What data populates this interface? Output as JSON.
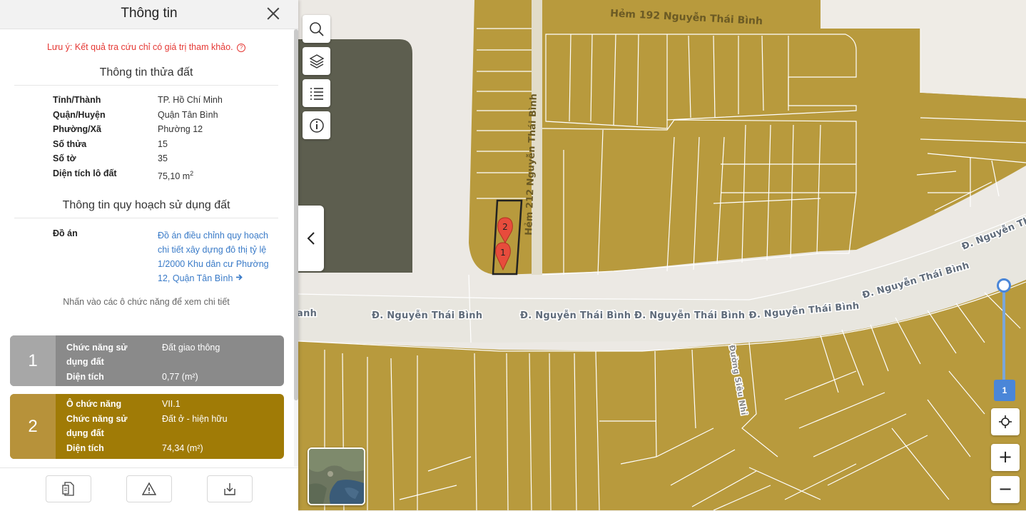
{
  "panel": {
    "title": "Thông tin",
    "note": "Lưu ý: Kết quả tra cứu chỉ có giá trị tham khảo.",
    "note_icon": "?",
    "land_section_title": "Thông tin thửa đất",
    "land_info": [
      {
        "label": "Tỉnh/Thành",
        "value": "TP. Hồ Chí Minh"
      },
      {
        "label": "Quận/Huyện",
        "value": "Quận Tân Bình"
      },
      {
        "label": "Phường/Xã",
        "value": "Phường 12"
      },
      {
        "label": "Số thửa",
        "value": "15"
      },
      {
        "label": "Số tờ",
        "value": "35"
      },
      {
        "label": "Diện tích lô đất",
        "value": "75,10 m",
        "value_sup": "2"
      }
    ],
    "plan_section_title": "Thông tin quy hoạch sử dụng đất",
    "plan_label": "Đồ án",
    "plan_value": "Đồ án điều chỉnh quy hoạch chi tiết xây dựng đô thị tỷ lệ 1/2000 Khu dân cư Phường 12, Quận Tân Bình",
    "hint": "Nhấn vào các ô chức năng để xem chi tiết",
    "functions": [
      {
        "number": "1",
        "color": "#8a8a8a",
        "rows": [
          {
            "label": "Chức năng sử dụng đất",
            "value": "Đất giao thông"
          },
          {
            "label": "Diện tích",
            "value": "0,77 (m²)"
          }
        ]
      },
      {
        "number": "2",
        "color": "#a07b06",
        "rows": [
          {
            "label": "Ô chức năng",
            "value": "VII.1"
          },
          {
            "label": "Chức năng sử dụng đất",
            "value": "Đất ở - hiện hữu"
          },
          {
            "label": "Diện tích",
            "value": "74,34 (m²)"
          }
        ]
      }
    ],
    "footer_buttons": [
      "document-icon",
      "warning-icon",
      "download-icon"
    ]
  },
  "map": {
    "streets": [
      "Hẻm 192 Nguyễn Thái Bình",
      "Hẻm 212 Nguyễn Thái Bình",
      "Đ. Nguyễn Thái Bình",
      "Đường Siêu Nhỉ"
    ],
    "street_label_fragment": "anh",
    "markers": [
      "1",
      "2"
    ],
    "colors": {
      "residential": "#b89a3d",
      "road": "#e8e6df",
      "park": "#5d5e4f",
      "parcel_outline": "#ffffff",
      "selected_outline": "#222222",
      "marker": "#e74c3c"
    },
    "tools": [
      "search-icon",
      "layers-icon",
      "list-icon",
      "info-icon"
    ],
    "zoom_level": "1",
    "zoom_in_label": "+",
    "zoom_out_label": "−",
    "locate_icon": "crosshair-icon"
  }
}
